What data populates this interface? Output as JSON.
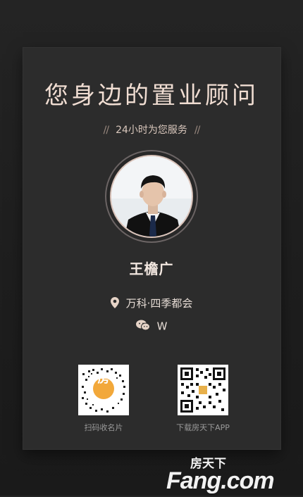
{
  "header": {
    "headline": "您身边的置业顾问",
    "subline": "24小时为您服务",
    "slash_left": "//",
    "slash_right": "//"
  },
  "agent": {
    "name": "王檐广",
    "location": "万科·四季都会",
    "wechat": "W"
  },
  "qr_codes": {
    "left_label": "扫码收名片",
    "left_center_text": "房",
    "right_label": "下载房天下APP"
  },
  "brand": {
    "logo_cn": "房天下",
    "logo_en": "Fang.com",
    "accent": "#e8c4b2"
  },
  "icons": [
    "location-pin-icon",
    "wechat-icon"
  ]
}
